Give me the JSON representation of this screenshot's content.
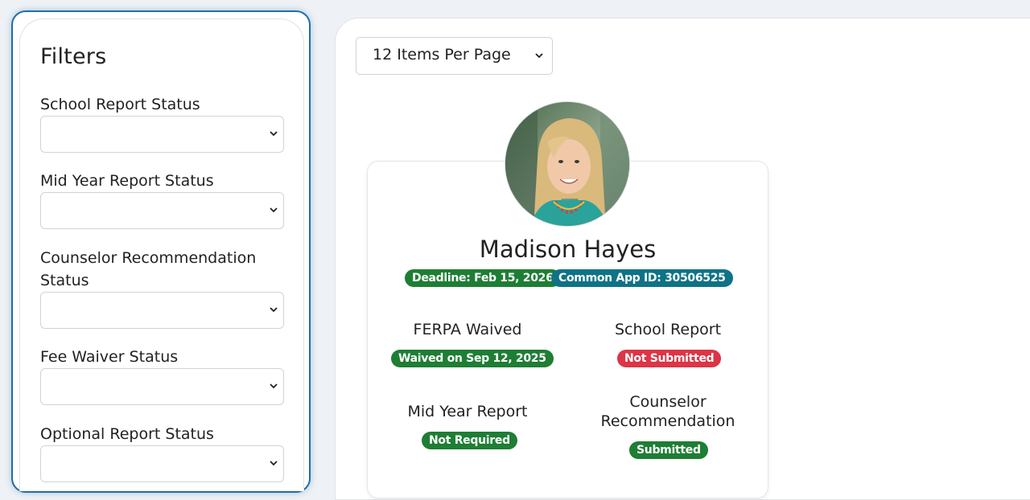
{
  "filters": {
    "title": "Filters",
    "items": [
      {
        "label": "School Report Status",
        "value": ""
      },
      {
        "label": "Mid Year Report Status",
        "value": ""
      },
      {
        "label": "Counselor Recommendation Status",
        "value": ""
      },
      {
        "label": "Fee Waiver Status",
        "value": ""
      },
      {
        "label": "Optional Report Status",
        "value": ""
      }
    ]
  },
  "pagination": {
    "per_page": "12 Items Per Page"
  },
  "student": {
    "name": "Madison Hayes",
    "deadline": "Deadline: Feb 15, 2026",
    "common_app_id": "Common App ID: 30506525",
    "ferpa": {
      "title": "FERPA Waived",
      "status": "Waived on Sep 12, 2025",
      "color": "#1e7e34"
    },
    "school_report": {
      "title": "School Report",
      "status": "Not Submitted",
      "color": "#dc3545"
    },
    "mid_year_report": {
      "title": "Mid Year Report",
      "status": "Not Required",
      "color": "#1e7e34"
    },
    "counselor_recommendation": {
      "title": "Counselor Recommendation",
      "status": "Submitted",
      "color": "#1e7e34"
    }
  },
  "icons": {
    "select_arrow": "chevron-down-icon",
    "avatar": "student-photo"
  },
  "colors": {
    "accent_border": "#1f6ea8",
    "badge_green": "#1e7e34",
    "badge_teal": "#0f7287",
    "badge_red": "#dc3545"
  }
}
